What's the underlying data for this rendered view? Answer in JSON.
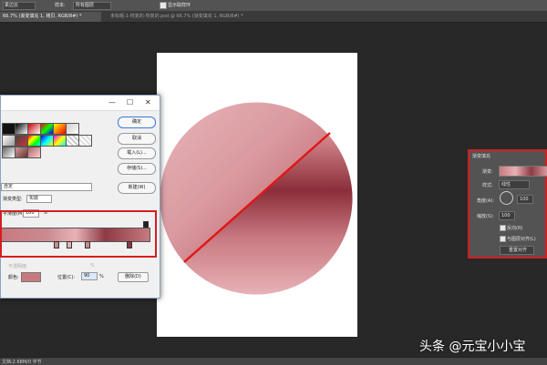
{
  "optionsbar": {
    "mode_label": "柔边云",
    "sample_label": "样本:",
    "sample_value": "所有图层",
    "show_ring_label": "显示取样环"
  },
  "tabs": [
    {
      "label": "66.7% (渐变填充 1, 拷贝, RGB/8#) *",
      "active": true
    },
    {
      "label": "未标题-1-恢复的-恢复的.psd @ 66.7% (渐变填充 1, RGB/8#) *",
      "active": false
    }
  ],
  "gradient_editor": {
    "buttons": {
      "ok": "确定",
      "cancel": "取消",
      "load": "载入(L)...",
      "save": "存储(S)...",
      "new": "新建(W)"
    },
    "name_value": "自定",
    "type_label": "渐变类型:",
    "type_value": "实底",
    "smooth_label": "平滑度(M):",
    "smooth_value": "100",
    "smooth_unit": "%",
    "stops_section": {
      "opacity_label": "不透明度:",
      "opacity_unit": "%",
      "color_label": "颜色:",
      "location_label": "位置(C):",
      "location_value": "90",
      "location_unit": "%",
      "delete_label": "删除(D)"
    },
    "colors": {
      "stop_color": "#c77a80"
    }
  },
  "fill_dialog": {
    "title": "渐变填充",
    "gradient_label": "渐变:",
    "style_label": "样式:",
    "style_value": "线性",
    "angle_label": "角度(A):",
    "angle_value": "100",
    "scale_label": "缩放(S):",
    "scale_value": "100",
    "reverse_label": "反向(R)",
    "align_label": "与图层对齐(L)",
    "reset_label": "重置对齐"
  },
  "status": {
    "text": "文档:2.68M/0 字节"
  },
  "watermark": "头条 @元宝小小宝"
}
